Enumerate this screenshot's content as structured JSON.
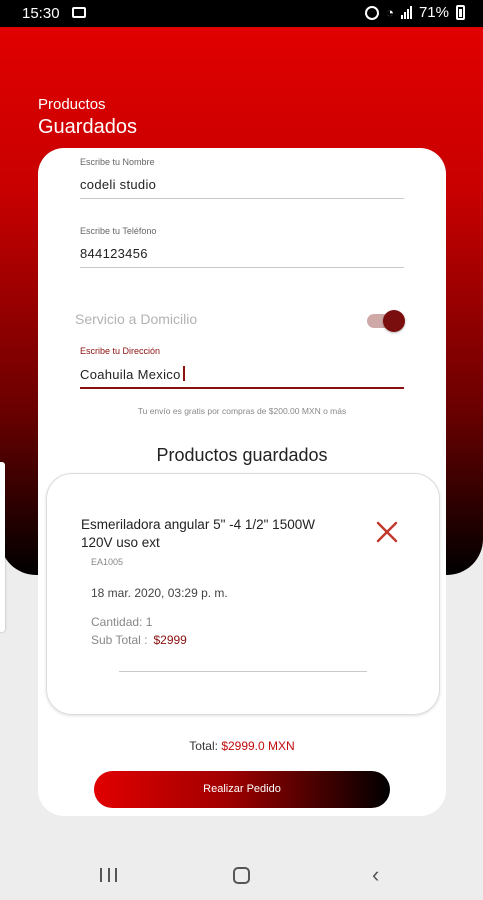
{
  "status_bar": {
    "time": "15:30",
    "battery": "71%"
  },
  "header": {
    "line1": "Productos",
    "line2": "Guardados"
  },
  "form": {
    "name": {
      "label": "Escribe tu Nombre",
      "value": "codeli studio"
    },
    "phone": {
      "label": "Escribe tu Teléfono",
      "value": "844123456"
    },
    "delivery": {
      "label": "Servicio a Domicilio",
      "enabled": true
    },
    "address": {
      "label": "Escribe tu Dirección",
      "value": "Coahuila Mexico"
    },
    "shipping_note": "Tu envío es gratis por compras de $200.00 MXN o más"
  },
  "saved_products": {
    "title": "Productos guardados",
    "items": [
      {
        "name": "Esmeriladora angular 5\" -4 1/2\" 1500W 120V uso ext",
        "code": "EA1005",
        "date": "18 mar. 2020,  03:29 p. m.",
        "quantity_label": "Cantidad: 1",
        "subtotal_label": "Sub Total :",
        "subtotal_value": "$2999"
      }
    ]
  },
  "summary": {
    "total_label": "Total:",
    "total_value": "$2999.0 MXN"
  },
  "actions": {
    "order_label": "Realizar Pedido"
  },
  "colors": {
    "brand_red": "#e00000",
    "accent_dark_red": "#8b1111"
  }
}
